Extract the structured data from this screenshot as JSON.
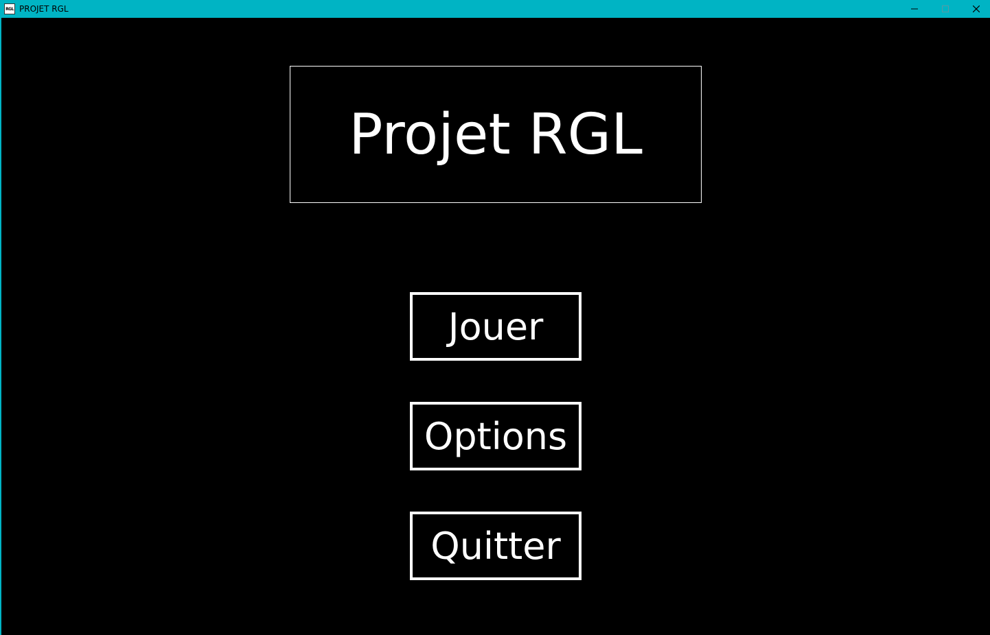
{
  "window": {
    "title": "PROJET RGL",
    "icon_text": "RGL",
    "titlebar_color": "#00b4c4",
    "controls": {
      "minimize_icon": "minimize-icon",
      "maximize_icon": "maximize-icon",
      "close_icon": "close-icon"
    }
  },
  "menu": {
    "game_title": "Projet RGL",
    "buttons": [
      {
        "label": "Jouer"
      },
      {
        "label": "Options"
      },
      {
        "label": "Quitter"
      }
    ]
  },
  "colors": {
    "background": "#000000",
    "foreground": "#ffffff"
  }
}
